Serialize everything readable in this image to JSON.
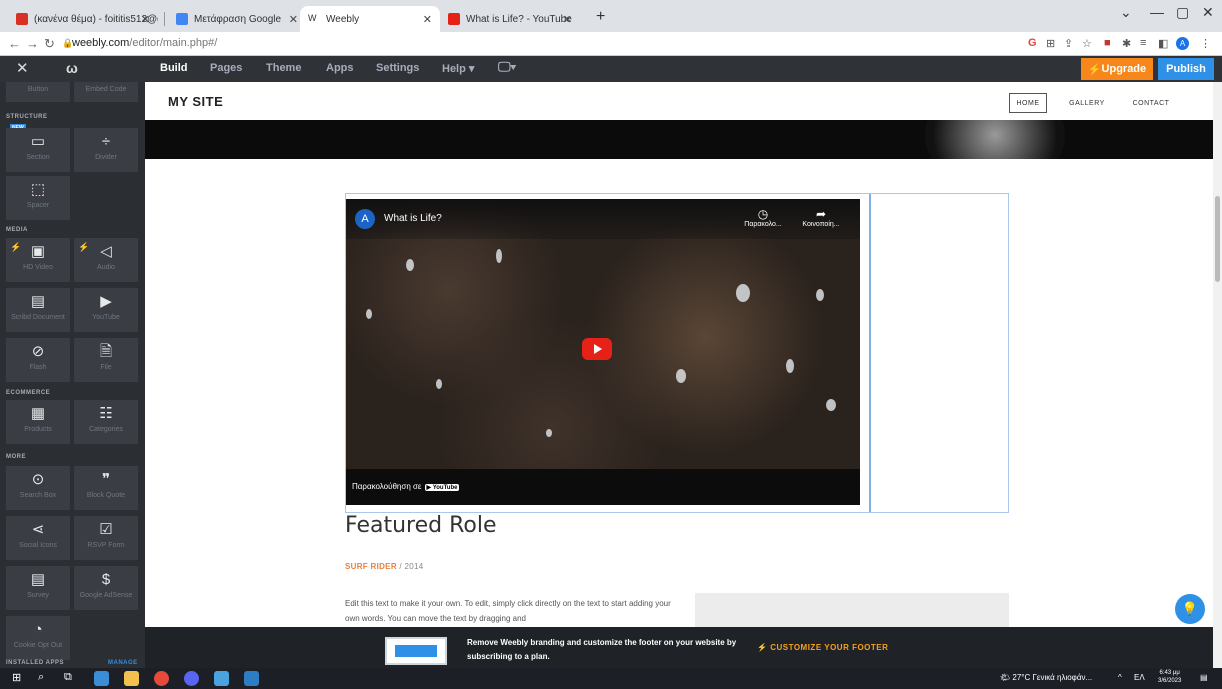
{
  "browser": {
    "tabs": [
      {
        "title": "(κανένα θέμα) - foititis512@gm..."
      },
      {
        "title": "Μετάφραση Google"
      },
      {
        "title": "Weebly"
      },
      {
        "title": "What is Life? - YouTube"
      }
    ],
    "url_domain": "weebly.com",
    "url_path": "/editor/main.php#/"
  },
  "editor": {
    "nav": [
      "Build",
      "Pages",
      "Theme",
      "Apps",
      "Settings",
      "Help"
    ],
    "upgrade_label": "Upgrade",
    "publish_label": "Publish"
  },
  "sidebar": {
    "top_partial": [
      "Button",
      "Embed Code"
    ],
    "structure_label": "STRUCTURE",
    "new_badge": "NEW",
    "structure": [
      "Section",
      "Divider",
      "Spacer"
    ],
    "media_label": "MEDIA",
    "media": [
      "HD Video",
      "Audio",
      "Scribd Document",
      "YouTube",
      "Flash",
      "File"
    ],
    "ecommerce_label": "ECOMMERCE",
    "ecommerce": [
      "Products",
      "Categories"
    ],
    "more_label": "MORE",
    "more": [
      "Search Box",
      "Block Quote",
      "Social Icons",
      "RSVP Form",
      "Survey",
      "Google AdSense",
      "Cookie Opt Out"
    ],
    "installed_label": "INSTALLED APPS",
    "manage_label": "MANAGE"
  },
  "site": {
    "title": "MY SITE",
    "nav": [
      "HOME",
      "GALLERY",
      "CONTACT"
    ]
  },
  "video": {
    "channel_initial": "A",
    "title": "What is Life?",
    "watch_later": "Παρακολο...",
    "share": "Κοινοποίη...",
    "watch_on": "Παρακολούθηση σε",
    "youtube": "YouTube"
  },
  "content": {
    "heading": "Featured Role",
    "role_accent": "SURF RIDER",
    "role_rest": " / 2014",
    "body": "Edit this text to make it your own. To edit, simply click directly on the text to start adding your own words. You can move the text by dragging and"
  },
  "promo": {
    "text": "Remove Weebly branding and customize the footer on your website by subscribing to a plan.",
    "cta": "CUSTOMIZE YOUR FOOTER"
  },
  "taskbar": {
    "weather": "27°C Γενικά ηλιοφάν...",
    "lang": "ΕΛ",
    "time": "6:43 μμ",
    "date": "3/6/2023"
  }
}
